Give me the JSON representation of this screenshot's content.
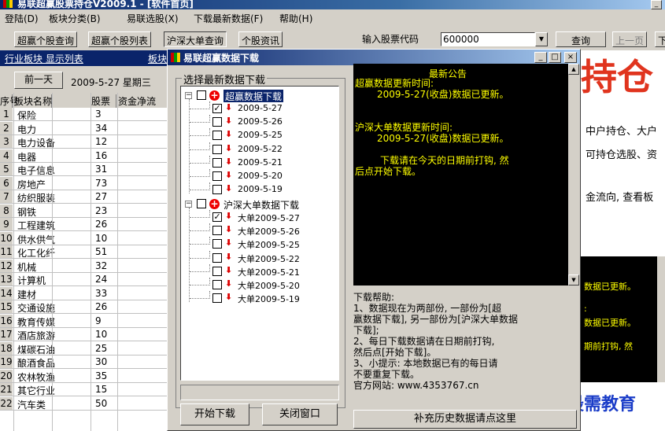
{
  "main_window": {
    "title": "易联超赢股票持仓V2009.1 - [软件首页]"
  },
  "menu": [
    "登陆(D)",
    "板块分类(B)",
    "易联选股(X)",
    "下载最新数据(F)",
    "帮助(H)"
  ],
  "toolbar": {
    "tabs": [
      "超赢个股查询",
      "超赢个股列表",
      "沪深大单查询",
      "个股资讯"
    ],
    "code_label": "输入股票代码",
    "code_value": "600000",
    "query_button": "查询",
    "prev_page": "上一页",
    "next_page": "下"
  },
  "left_panel": {
    "tabs": [
      "行业板块 显示列表",
      "板块"
    ],
    "prev_day": "前一天",
    "date": "2009-5-27 星期三",
    "headers": [
      "序号",
      "板块名称",
      "股票",
      "资金净流"
    ],
    "rows": [
      [
        "1",
        "保险",
        "3"
      ],
      [
        "2",
        "电力",
        "34"
      ],
      [
        "3",
        "电力设备",
        "12"
      ],
      [
        "4",
        "电器",
        "16"
      ],
      [
        "5",
        "电子信息",
        "31"
      ],
      [
        "6",
        "房地产",
        "73"
      ],
      [
        "7",
        "纺织服装",
        "27"
      ],
      [
        "8",
        "钢铁",
        "23"
      ],
      [
        "9",
        "工程建筑",
        "26"
      ],
      [
        "10",
        "供水供气",
        "10"
      ],
      [
        "11",
        "化工化纤",
        "51"
      ],
      [
        "12",
        "机械",
        "32"
      ],
      [
        "13",
        "计算机",
        "24"
      ],
      [
        "14",
        "建材",
        "33"
      ],
      [
        "15",
        "交通设施",
        "26"
      ],
      [
        "16",
        "教育传媒",
        "9"
      ],
      [
        "17",
        "酒店旅游",
        "10"
      ],
      [
        "18",
        "煤碳石油",
        "25"
      ],
      [
        "19",
        "酿酒食品",
        "30"
      ],
      [
        "20",
        "农林牧渔",
        "35"
      ],
      [
        "21",
        "其它行业",
        "15"
      ],
      [
        "22",
        "汽车类",
        "50"
      ]
    ]
  },
  "dialog": {
    "title": "易联超赢数据下载",
    "tree_label": "选择最新数据下载",
    "group1": {
      "label": "超赢数据下载",
      "items": [
        "2009-5-27",
        "2009-5-26",
        "2009-5-25",
        "2009-5-22",
        "2009-5-21",
        "2009-5-20",
        "2009-5-19"
      ],
      "checked_index": 0
    },
    "group2": {
      "label": "沪深大单数据下载",
      "items": [
        "大单2009-5-27",
        "大单2009-5-26",
        "大单2009-5-25",
        "大单2009-5-22",
        "大单2009-5-21",
        "大单2009-5-20",
        "大单2009-5-19"
      ],
      "checked_index": 0
    },
    "start_button": "开始下载",
    "close_button": "关闭窗口",
    "announcement": {
      "title": "最新公告",
      "lines": [
        "超赢数据更新时间:",
        "2009-5-27(收盘)数据已更新。",
        "沪深大单数据更新时间:",
        "2009-5-27(收盘)数据已更新。",
        "下载请在今天的日期前打钩, 然",
        "后点开始下载。"
      ]
    },
    "help": [
      "下载帮助:",
      "    1、数据现在为两部份, 一部份为[超",
      "赢数据下载], 另一部份为[沪深大单数据",
      "下载];",
      "    2、每日下载数据请在日期前打钩,",
      "然后点[开始下载]。",
      "    3、小提示: 本地数据已有的每日请",
      "不要重复下载。",
      "官方网站: www.4353767.cn"
    ],
    "history_button": "补充历史数据请点这里"
  },
  "background_right": {
    "banner": "持仓",
    "lines": [
      "中户持仓、大户",
      "可持仓选股、资",
      "金流向, 查看板"
    ],
    "announce_lines": [
      "数据已更新。",
      ":",
      "数据已更新。",
      "期前打钩, 然"
    ],
    "watermark": "最需教育"
  },
  "colors": {
    "title_bar": "#0a246a",
    "announce_bg": "#000000",
    "announce_text": "#ffff00",
    "banner": "#e0341e"
  }
}
